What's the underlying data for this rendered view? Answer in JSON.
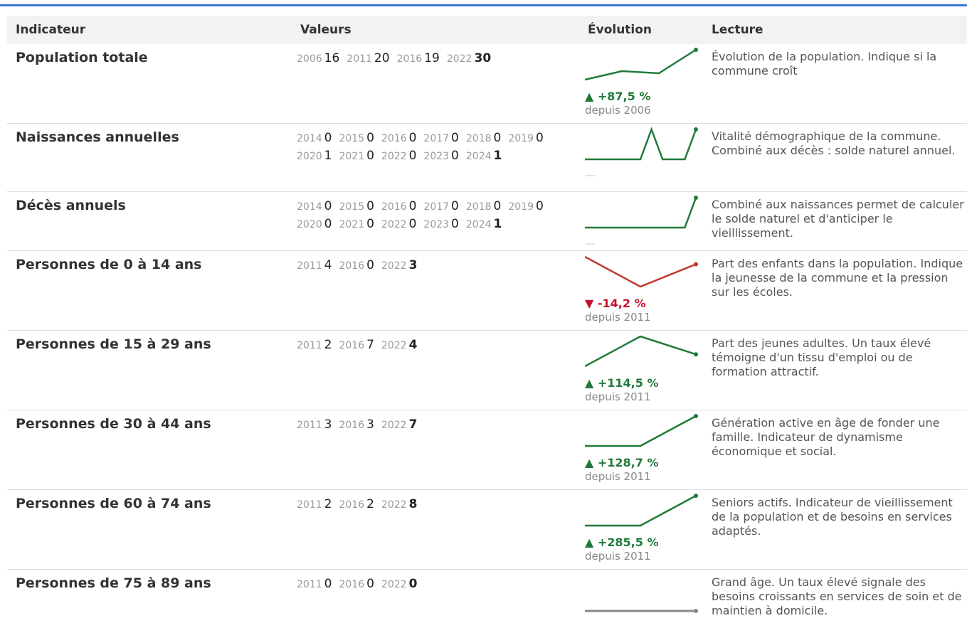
{
  "headers": {
    "indicateur": "Indicateur",
    "valeurs": "Valeurs",
    "evolution": "Évolution",
    "lecture": "Lecture"
  },
  "colors": {
    "accent": "#3a76d8",
    "up": "#1f7a3a",
    "down": "#c8102e",
    "downline": "#c0392b",
    "flat": "#888888"
  },
  "rows": [
    {
      "name": "Population totale",
      "values": [
        {
          "y": "2006",
          "v": "16"
        },
        {
          "y": "2011",
          "v": "20"
        },
        {
          "y": "2016",
          "v": "19"
        },
        {
          "y": "2022",
          "v": "30"
        }
      ],
      "trend": "up",
      "delta": "▲ +87,5 %",
      "since": "depuis 2006",
      "lecture": "Évolution de la population. Indique si la commune croît"
    },
    {
      "name": "Naissances annuelles",
      "values": [
        {
          "y": "2014",
          "v": "0"
        },
        {
          "y": "2015",
          "v": "0"
        },
        {
          "y": "2016",
          "v": "0"
        },
        {
          "y": "2017",
          "v": "0"
        },
        {
          "y": "2018",
          "v": "0"
        },
        {
          "y": "2019",
          "v": "0"
        },
        {
          "y": "2020",
          "v": "1"
        },
        {
          "y": "2021",
          "v": "0"
        },
        {
          "y": "2022",
          "v": "0"
        },
        {
          "y": "2023",
          "v": "0"
        },
        {
          "y": "2024",
          "v": "1"
        }
      ],
      "trend": "up",
      "delta": "",
      "since": "",
      "lecture": "Vitalité démographique de la commune. Combiné aux décès : solde naturel annuel."
    },
    {
      "name": "Décès annuels",
      "values": [
        {
          "y": "2014",
          "v": "0"
        },
        {
          "y": "2015",
          "v": "0"
        },
        {
          "y": "2016",
          "v": "0"
        },
        {
          "y": "2017",
          "v": "0"
        },
        {
          "y": "2018",
          "v": "0"
        },
        {
          "y": "2019",
          "v": "0"
        },
        {
          "y": "2020",
          "v": "0"
        },
        {
          "y": "2021",
          "v": "0"
        },
        {
          "y": "2022",
          "v": "0"
        },
        {
          "y": "2023",
          "v": "0"
        },
        {
          "y": "2024",
          "v": "1"
        }
      ],
      "trend": "up",
      "delta": "",
      "since": "",
      "lecture": "Combiné aux naissances permet de calculer le solde naturel et d'anticiper le vieillissement."
    },
    {
      "name": "Personnes de 0 à 14 ans",
      "values": [
        {
          "y": "2011",
          "v": "4"
        },
        {
          "y": "2016",
          "v": "0"
        },
        {
          "y": "2022",
          "v": "3"
        }
      ],
      "trend": "down",
      "delta": "▼ -14,2 %",
      "since": "depuis 2011",
      "lecture": "Part des enfants dans la population. Indique la jeunesse de la commune et la pression sur les écoles."
    },
    {
      "name": "Personnes de 15 à 29 ans",
      "values": [
        {
          "y": "2011",
          "v": "2"
        },
        {
          "y": "2016",
          "v": "7"
        },
        {
          "y": "2022",
          "v": "4"
        }
      ],
      "trend": "up",
      "delta": "▲ +114,5 %",
      "since": "depuis 2011",
      "lecture": "Part des jeunes adultes. Un taux élevé témoigne d'un tissu d'emploi ou de formation attractif."
    },
    {
      "name": "Personnes de 30 à 44 ans",
      "values": [
        {
          "y": "2011",
          "v": "3"
        },
        {
          "y": "2016",
          "v": "3"
        },
        {
          "y": "2022",
          "v": "7"
        }
      ],
      "trend": "up",
      "delta": "▲ +128,7 %",
      "since": "depuis 2011",
      "lecture": "Génération active en âge de fonder une famille. Indicateur de dynamisme économique et social."
    },
    {
      "name": "Personnes de 60 à 74 ans",
      "values": [
        {
          "y": "2011",
          "v": "2"
        },
        {
          "y": "2016",
          "v": "2"
        },
        {
          "y": "2022",
          "v": "8"
        }
      ],
      "trend": "up",
      "delta": "▲ +285,5 %",
      "since": "depuis 2011",
      "lecture": "Seniors actifs. Indicateur de vieillissement de la population et de besoins en services adaptés."
    },
    {
      "name": "Personnes de 75 à 89 ans",
      "values": [
        {
          "y": "2011",
          "v": "0"
        },
        {
          "y": "2016",
          "v": "0"
        },
        {
          "y": "2022",
          "v": "0"
        }
      ],
      "trend": "flat",
      "delta": "",
      "since": "",
      "lecture": "Grand âge. Un taux élevé signale des besoins croissants en services de soin et de maintien à domicile."
    }
  ]
}
